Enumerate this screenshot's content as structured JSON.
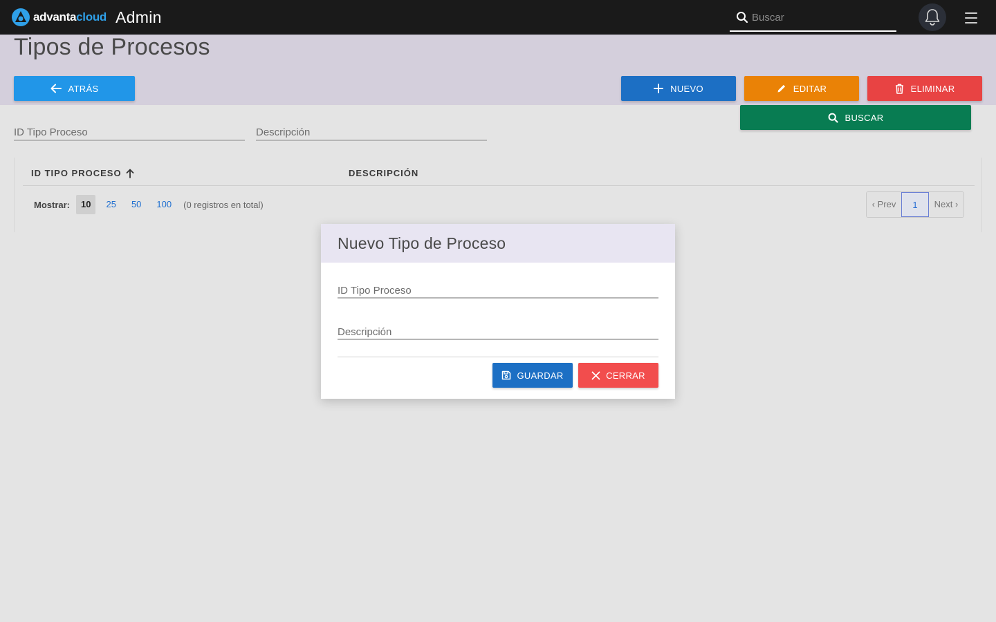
{
  "app": {
    "logo_part1": "advanta",
    "logo_part2": "cloud",
    "title": "Admin"
  },
  "topbar": {
    "search_placeholder": "Buscar",
    "icons": [
      "search-icon",
      "bell-icon",
      "hamburger-menu-icon"
    ]
  },
  "page": {
    "title": "Tipos de Procesos"
  },
  "actions": {
    "back_label": "ATRÁS",
    "new_label": "NUEVO",
    "edit_label": "EDITAR",
    "delete_label": "ELIMINAR",
    "search_label": "BUSCAR"
  },
  "filters": {
    "id_placeholder": "ID Tipo Proceso",
    "desc_placeholder": "Descripción"
  },
  "table": {
    "columns": [
      "ID TIPO PROCESO",
      "DESCRIPCIÓN"
    ],
    "sort_column": "ID TIPO PROCESO",
    "sort_direction": "ascending",
    "rows": []
  },
  "pagination": {
    "show_label": "Mostrar:",
    "page_sizes": [
      "10",
      "25",
      "50",
      "100"
    ],
    "selected_page_size": "10",
    "total_text": "(0 registros en total)",
    "prev_label": "‹ Prev",
    "current_page": "1",
    "next_label": "Next ›"
  },
  "modal": {
    "title": "Nuevo Tipo de Proceso",
    "id_placeholder": "ID Tipo Proceso",
    "desc_placeholder": "Descripción",
    "save_label": "GUARDAR",
    "close_label": "CERRAR"
  },
  "colors": {
    "topbar": "#1a1a1a",
    "header_band": "#d4cfdc",
    "back_button": "#2196e8",
    "new_button": "#1c6fc4",
    "edit_button": "#ea8206",
    "delete_button": "#e84343",
    "search_button": "#087c52",
    "save_button": "#1c6fc4",
    "close_button": "#f24d4d"
  }
}
